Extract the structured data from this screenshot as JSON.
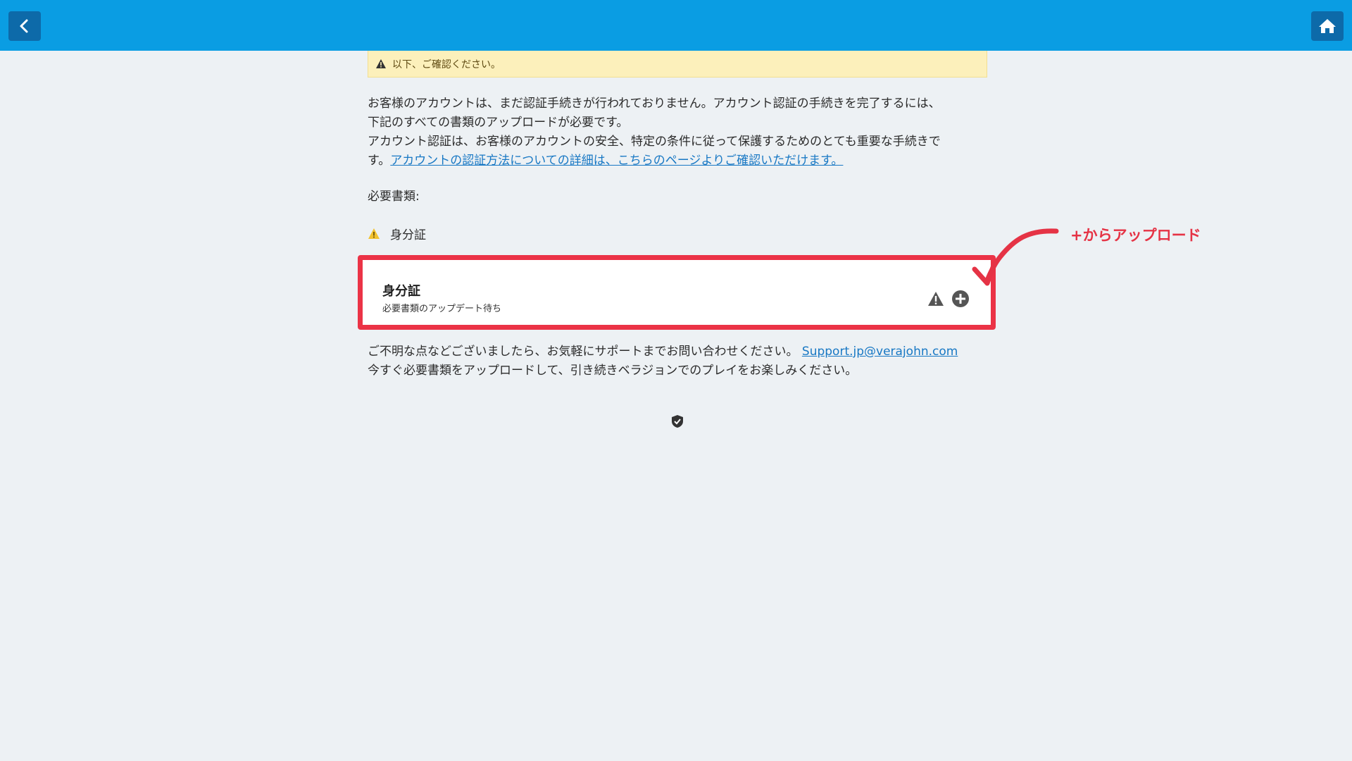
{
  "header": {
    "back_icon": "chevron-left-icon",
    "home_icon": "home-icon",
    "color": "#0a9de3"
  },
  "notice": {
    "text": "以下、ご確認ください。",
    "icon": "warning-icon"
  },
  "intro": {
    "line1": "お客様のアカウントは、まだ認証手続きが行われておりません。アカウント認証の手続きを完了するには、",
    "line2": "下記のすべての書類のアップロードが必要です。",
    "line3": "アカウント認証は、お客様のアカウントの安全、特定の条件に従って保護するためのとても重要な手続きで",
    "line4_prefix": "す。",
    "link_text": "アカウントの認証方法についての詳細は、こちらのページよりご確認いただけます。"
  },
  "required_docs_label": "必要書類:",
  "documents": [
    {
      "heading": "身分証",
      "card_title": "身分証",
      "card_status": "必要書類のアップデート待ち"
    }
  ],
  "contact": {
    "text": "ご不明な点などございましたら、お気軽にサポートまでお問い合わせください。",
    "email": "Support.jp@verajohn.com",
    "line2": "今すぐ必要書類をアップロードして、引き続きベラジョンでのプレイをお楽しみください。"
  },
  "annotation": {
    "text": "+からアップロード",
    "color": "#e53345"
  }
}
